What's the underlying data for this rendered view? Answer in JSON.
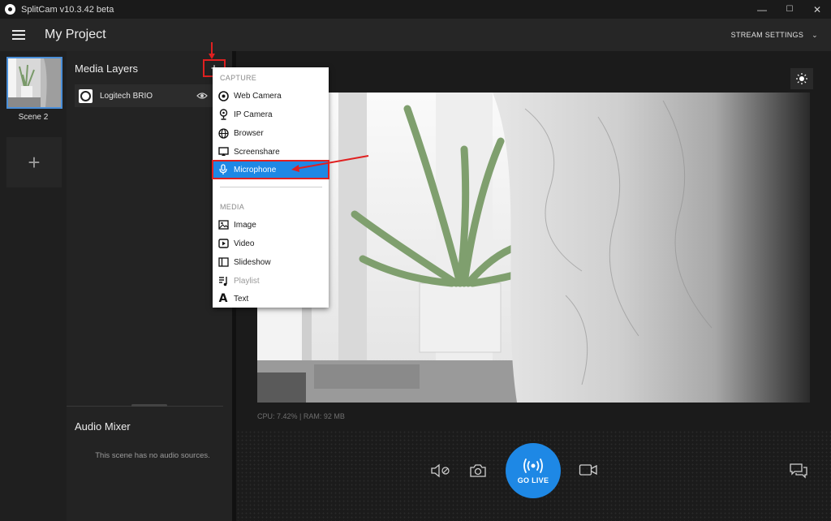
{
  "window": {
    "title": "SplitCam v10.3.42 beta",
    "minimize": "—",
    "maximize": "☐",
    "close": "✕"
  },
  "header": {
    "project_title": "My Project",
    "stream_settings": "STREAM SETTINGS"
  },
  "scenes": {
    "items": [
      {
        "label": "Scene 2"
      }
    ],
    "add_label": "+"
  },
  "layers": {
    "heading": "Media Layers",
    "add_label": "+",
    "items": [
      {
        "name": "Logitech BRIO"
      }
    ]
  },
  "audio_mixer": {
    "heading": "Audio Mixer",
    "empty_text": "This scene has no audio sources."
  },
  "add_menu": {
    "capture_heading": "CAPTURE",
    "media_heading": "MEDIA",
    "capture_items": [
      {
        "label": "Web Camera",
        "icon": "webcam-icon"
      },
      {
        "label": "IP Camera",
        "icon": "ip-camera-icon"
      },
      {
        "label": "Browser",
        "icon": "globe-icon"
      },
      {
        "label": "Screenshare",
        "icon": "screenshare-icon"
      },
      {
        "label": "Microphone",
        "icon": "microphone-icon",
        "selected": true
      }
    ],
    "media_items": [
      {
        "label": "Image",
        "icon": "image-icon"
      },
      {
        "label": "Video",
        "icon": "video-play-icon"
      },
      {
        "label": "Slideshow",
        "icon": "slideshow-icon"
      },
      {
        "label": "Playlist",
        "icon": "playlist-icon",
        "disabled": true
      },
      {
        "label": "Text",
        "icon": "text-icon"
      }
    ]
  },
  "preview": {
    "stats": "CPU: 7.42% | RAM: 92 MB"
  },
  "controls": {
    "go_live": "GO LIVE"
  },
  "colors": {
    "accent": "#1e88e5",
    "annotation": "#e02020",
    "background": "#1c1c1c"
  }
}
